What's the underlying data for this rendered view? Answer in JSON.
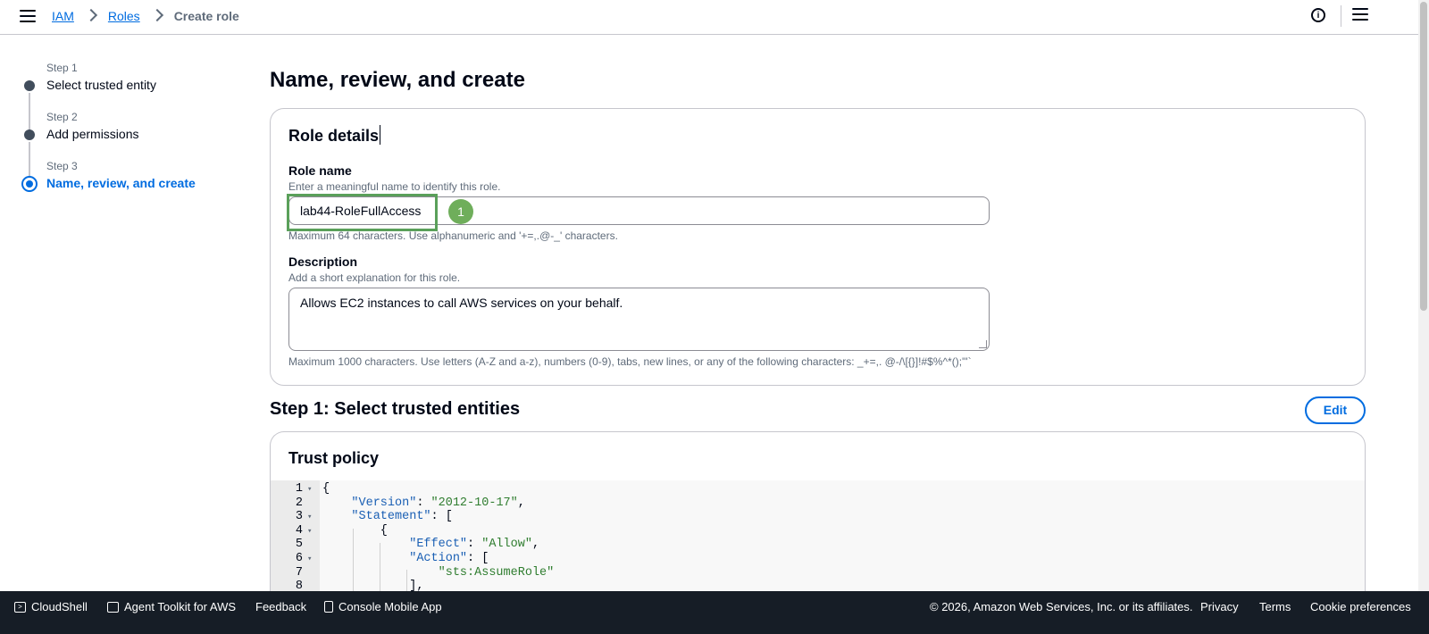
{
  "header": {
    "breadcrumbs": [
      {
        "label": "IAM",
        "link": true
      },
      {
        "label": "Roles",
        "link": true
      },
      {
        "label": "Create role",
        "link": false
      }
    ]
  },
  "steps": [
    {
      "small": "Step 1",
      "title": "Select trusted entity",
      "active": false
    },
    {
      "small": "Step 2",
      "title": "Add permissions",
      "active": false
    },
    {
      "small": "Step 3",
      "title": "Name, review, and create",
      "active": true
    }
  ],
  "page_title": "Name, review, and create",
  "role_details": {
    "title": "Role details",
    "role_name": {
      "label": "Role name",
      "description": "Enter a meaningful name to identify this role.",
      "value": "lab44-RoleFullAccess",
      "constraint": "Maximum 64 characters. Use alphanumeric and '+=,.@-_' characters."
    },
    "description": {
      "label": "Description",
      "description": "Add a short explanation for this role.",
      "value": "Allows EC2 instances to call AWS services on your behalf.",
      "constraint": "Maximum 1000 characters. Use letters (A-Z and a-z), numbers (0-9), tabs, new lines, or any of the following characters: _+=,. @-/\\[{}]!#$%^*();\"'`"
    },
    "annotation_badge": "1"
  },
  "step1": {
    "title": "Step 1: Select trusted entities",
    "edit_label": "Edit",
    "trust_policy_title": "Trust policy",
    "code_lines": [
      {
        "n": "1",
        "fold": true,
        "text": "{"
      },
      {
        "n": "2",
        "fold": false,
        "text": "    \"Version\": \"2012-10-17\","
      },
      {
        "n": "3",
        "fold": true,
        "text": "    \"Statement\": ["
      },
      {
        "n": "4",
        "fold": true,
        "text": "        {"
      },
      {
        "n": "5",
        "fold": false,
        "text": "            \"Effect\": \"Allow\","
      },
      {
        "n": "6",
        "fold": true,
        "text": "            \"Action\": ["
      },
      {
        "n": "7",
        "fold": false,
        "text": "                \"sts:AssumeRole\""
      },
      {
        "n": "8",
        "fold": false,
        "text": "            ],"
      }
    ]
  },
  "footer": {
    "cloudshell": "CloudShell",
    "agent_toolkit": "Agent Toolkit for AWS",
    "feedback": "Feedback",
    "mobile_app": "Console Mobile App",
    "copyright": "© 2026, Amazon Web Services, Inc. or its affiliates.",
    "privacy": "Privacy",
    "terms": "Terms",
    "cookies": "Cookie preferences"
  },
  "icons": [
    "menu-icon",
    "chevron-right-icon",
    "info-icon",
    "split-panel-icon",
    "terminal-icon",
    "toolkit-icon",
    "mobile-icon",
    "collapse-arrow-icon"
  ],
  "colors": {
    "link": "#006ce0",
    "footer_bg": "#161d26",
    "highlight": "#5aa05a"
  }
}
